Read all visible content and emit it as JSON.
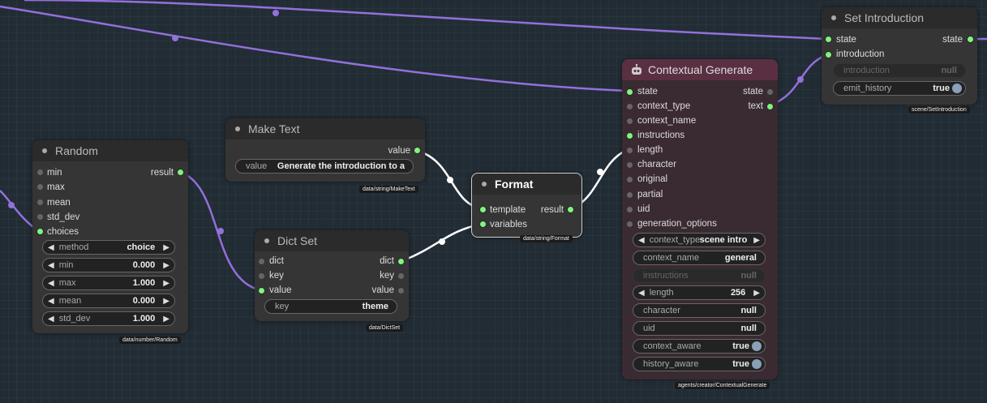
{
  "nodes": {
    "random": {
      "title": "Random",
      "inputs": [
        "min",
        "max",
        "mean",
        "std_dev",
        "choices"
      ],
      "output": "result",
      "widgets": [
        {
          "label": "method",
          "value": "choice"
        },
        {
          "label": "min",
          "value": "0.000"
        },
        {
          "label": "max",
          "value": "1.000"
        },
        {
          "label": "mean",
          "value": "0.000"
        },
        {
          "label": "std_dev",
          "value": "1.000"
        }
      ],
      "path": "data/number/Random"
    },
    "make_text": {
      "title": "Make Text",
      "output": "value",
      "widget": {
        "label": "value",
        "value": "Generate the introduction to a"
      },
      "path": "data/string/MakeText"
    },
    "dict_set": {
      "title": "Dict Set",
      "inputs": [
        "dict",
        "key",
        "value"
      ],
      "outputs": [
        "dict",
        "key",
        "value"
      ],
      "widget": {
        "label": "key",
        "value": "theme"
      },
      "path": "data/DictSet"
    },
    "format": {
      "title": "Format",
      "inputs": [
        "template",
        "variables"
      ],
      "output": "result",
      "path": "data/string/Format"
    },
    "contextual_generate": {
      "title": "Contextual Generate",
      "inputs": [
        "state",
        "context_type",
        "context_name",
        "instructions",
        "length",
        "character",
        "original",
        "partial",
        "uid",
        "generation_options"
      ],
      "outputs": [
        "state",
        "text"
      ],
      "widgets": [
        {
          "label": "context_type",
          "value": "scene intro"
        },
        {
          "label": "context_name",
          "value": "general"
        },
        {
          "label": "instructions",
          "value": "null"
        },
        {
          "label": "length",
          "value": "256"
        },
        {
          "label": "character",
          "value": "null"
        },
        {
          "label": "uid",
          "value": "null"
        },
        {
          "label": "context_aware",
          "value": "true"
        },
        {
          "label": "history_aware",
          "value": "true"
        }
      ],
      "path": "agents/creator/ContextualGenerate"
    },
    "set_introduction": {
      "title": "Set Introduction",
      "inputs": [
        "state",
        "introduction"
      ],
      "output": "state",
      "widgets": [
        {
          "label": "introduction",
          "value": "null"
        },
        {
          "label": "emit_history",
          "value": "true"
        }
      ],
      "path": "scene/SetIntroduction"
    }
  },
  "colors": {
    "link": "#9370db",
    "link_white": "#ffffff",
    "pin_connected": "#7ef57e",
    "generate_title": "#5a2f42"
  }
}
